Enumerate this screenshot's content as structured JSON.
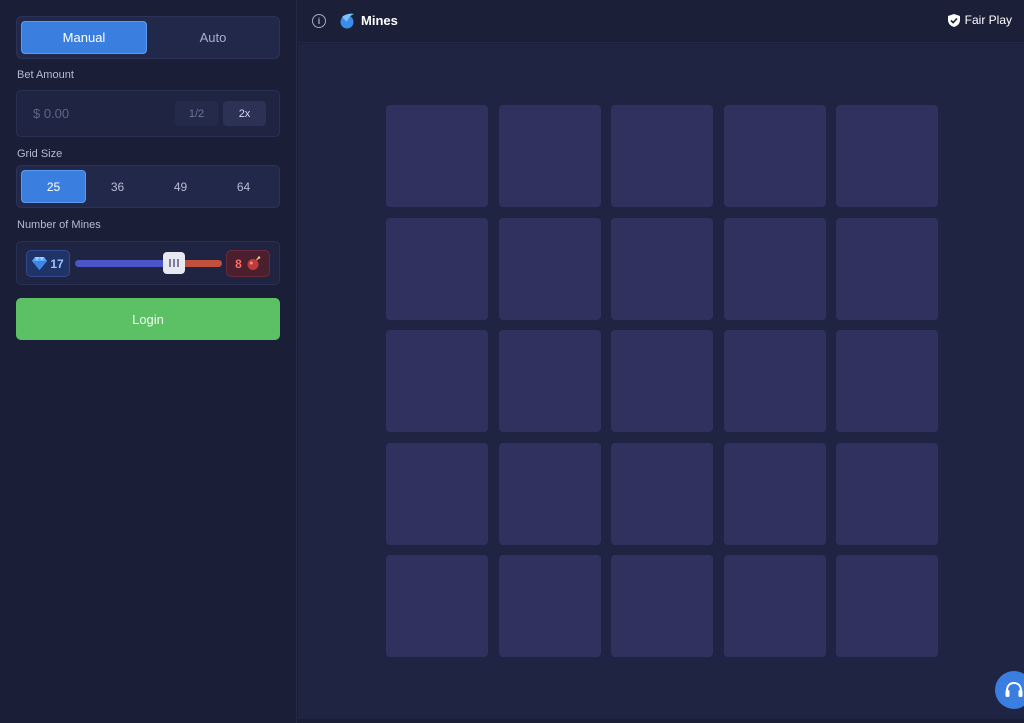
{
  "sidebar": {
    "mode_tabs": [
      {
        "label": "Manual",
        "active": true
      },
      {
        "label": "Auto",
        "active": false
      }
    ],
    "bet": {
      "label": "Bet Amount",
      "placeholder": "$ 0.00",
      "half_label": "1/2",
      "double_label": "2x"
    },
    "grid_size": {
      "label": "Grid Size",
      "options": [
        "25",
        "36",
        "49",
        "64"
      ],
      "selected": "25"
    },
    "mines": {
      "label": "Number of Mines",
      "gems_count": "17",
      "mines_count": "8",
      "slider_fraction": 0.68
    },
    "login_label": "Login"
  },
  "header": {
    "title": "Mines",
    "fair_play_label": "Fair Play"
  },
  "colors": {
    "accent_blue": "#3a7fe0",
    "login_green": "#5cc064",
    "tile": "#30315f",
    "background": "#1a1e36"
  },
  "icons": {
    "info": "info-icon",
    "logo": "mines-logo-icon",
    "fair_play": "shield-check-icon",
    "gem": "diamond-icon",
    "bomb": "bomb-icon",
    "support": "headset-icon"
  }
}
